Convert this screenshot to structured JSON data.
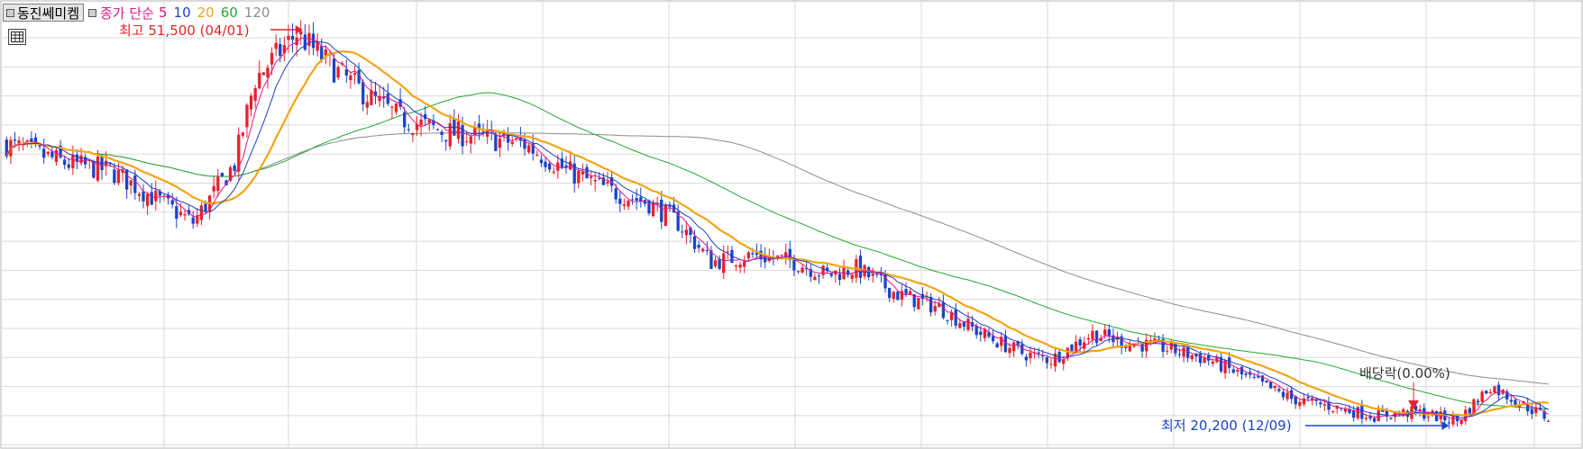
{
  "header": {
    "stock_name": "동진쎄미켐",
    "ma_label": "종가 단순",
    "ma_periods": [
      "5",
      "10",
      "20",
      "60",
      "120"
    ]
  },
  "colors": {
    "up": "#e8212b",
    "down": "#1a43c8",
    "ma5": "#e0198c",
    "ma10": "#1f3fc4",
    "ma20": "#f2a516",
    "ma60": "#1faa31",
    "ma120": "#8c8c8c",
    "grid": "#d9d9d9"
  },
  "annotations": {
    "high_label": "최고 51,500 (04/01)",
    "low_label": "최저 20,200 (12/09)",
    "dividend_label": "배당락(0.00%)"
  },
  "chart_data": {
    "type": "candlestick",
    "title": "",
    "series_names": [
      "5",
      "10",
      "20",
      "60",
      "120"
    ],
    "high": {
      "value": 51500,
      "date": "04/01"
    },
    "low": {
      "value": 20200,
      "date": "12/09"
    },
    "approx_close_path": [
      [
        0,
        42000
      ],
      [
        15,
        40500
      ],
      [
        25,
        40000
      ],
      [
        35,
        38000
      ],
      [
        45,
        36000
      ],
      [
        55,
        40500
      ],
      [
        60,
        47000
      ],
      [
        70,
        50500
      ],
      [
        80,
        47500
      ],
      [
        88,
        45500
      ],
      [
        95,
        44000
      ],
      [
        105,
        43000
      ],
      [
        115,
        42500
      ],
      [
        125,
        42000
      ],
      [
        135,
        40000
      ],
      [
        145,
        38500
      ],
      [
        155,
        37500
      ],
      [
        162,
        36000
      ],
      [
        170,
        33000
      ],
      [
        180,
        33500
      ],
      [
        190,
        33000
      ],
      [
        198,
        32000
      ],
      [
        205,
        32500
      ],
      [
        215,
        30500
      ],
      [
        225,
        29500
      ],
      [
        235,
        27500
      ],
      [
        245,
        26000
      ],
      [
        252,
        25500
      ],
      [
        262,
        27500
      ],
      [
        270,
        26800
      ],
      [
        278,
        26500
      ],
      [
        290,
        25500
      ],
      [
        300,
        24000
      ],
      [
        310,
        22500
      ],
      [
        318,
        22000
      ],
      [
        330,
        21200
      ],
      [
        340,
        21500
      ],
      [
        350,
        20800
      ],
      [
        358,
        23500
      ],
      [
        365,
        22200
      ],
      [
        372,
        21000
      ]
    ]
  }
}
